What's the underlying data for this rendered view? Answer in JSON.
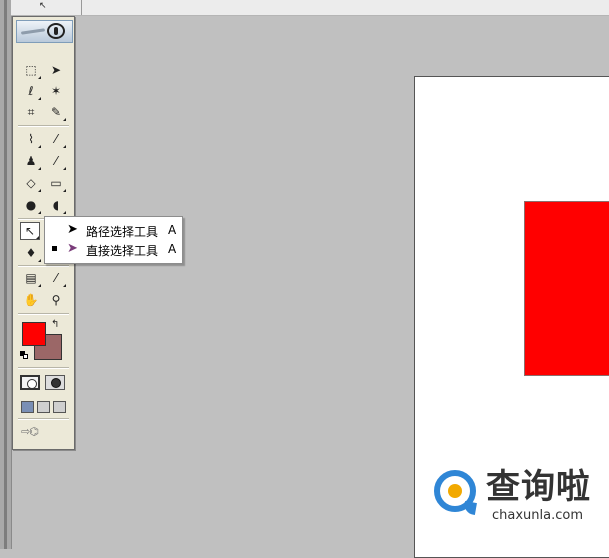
{
  "flyout": {
    "items": [
      {
        "label": "路径选择工具",
        "shortcut": "A",
        "selected": false
      },
      {
        "label": "直接选择工具",
        "shortcut": "A",
        "selected": true
      }
    ]
  },
  "colors": {
    "foreground": "#ff0000",
    "background": "#9b6767",
    "shape_fill": "#ff0000"
  },
  "watermark": {
    "name": "查询啦",
    "domain": "chaxunla.com"
  },
  "tools": [
    "rectangular-marquee-icon",
    "move-icon",
    "lasso-icon",
    "magic-wand-icon",
    "crop-icon",
    "slice-icon",
    "healing-brush-icon",
    "brush-icon",
    "clone-stamp-icon",
    "history-brush-icon",
    "eraser-icon",
    "gradient-icon",
    "blur-icon",
    "dodge-icon",
    "path-selection-icon",
    "text-icon",
    "pen-icon",
    "shape-icon",
    "notes-icon",
    "eyedropper-icon",
    "hand-icon",
    "zoom-icon"
  ]
}
